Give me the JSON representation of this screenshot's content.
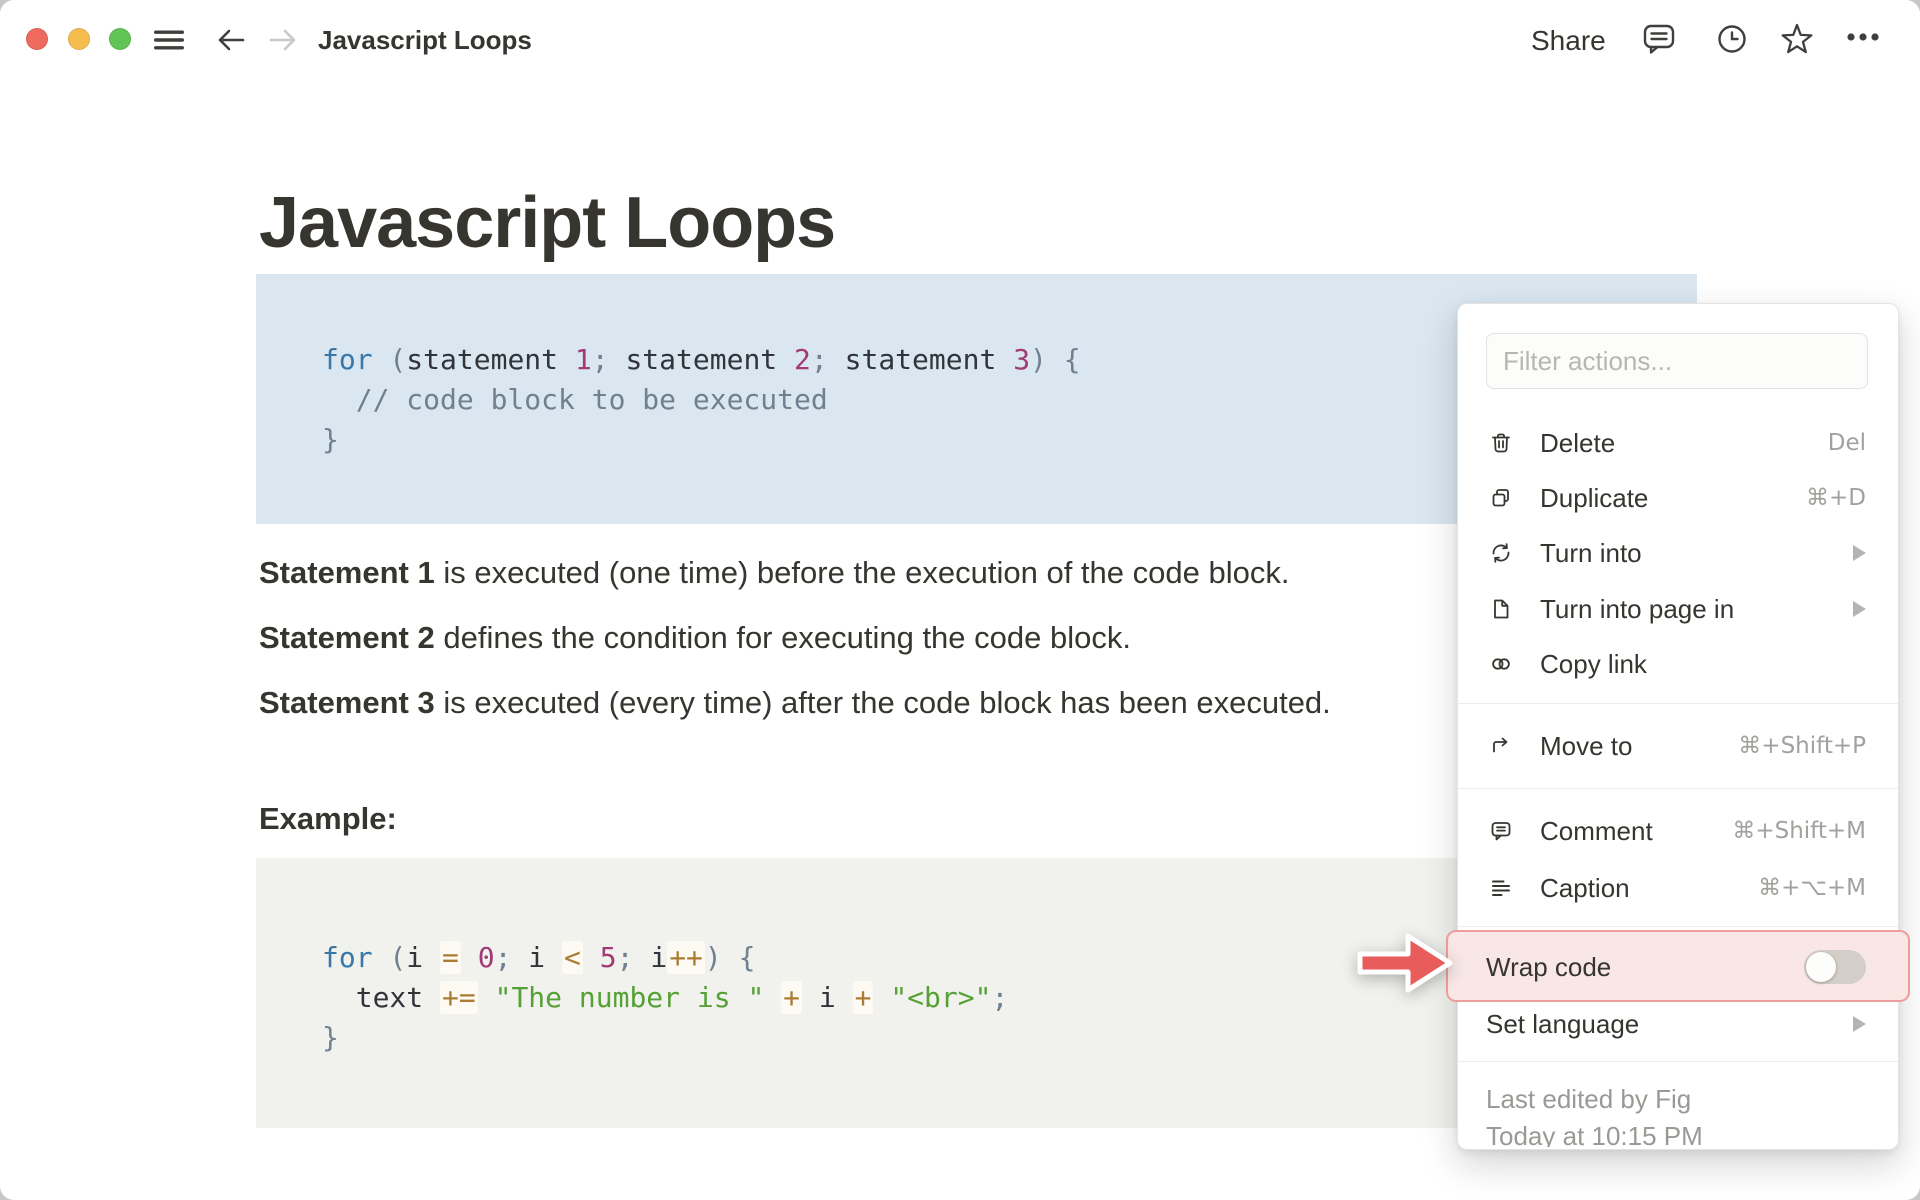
{
  "titlebar": {
    "title": "Javascript Loops",
    "share": "Share",
    "icons": [
      "hamburger-icon",
      "back-icon",
      "forward-icon",
      "comment-bubble-icon",
      "history-clock-icon",
      "star-icon",
      "more-ellipsis-icon"
    ],
    "traffic_lights": [
      "close",
      "minimize",
      "zoom"
    ]
  },
  "doc": {
    "title": "Javascript Loops",
    "paragraphs": [
      {
        "lead": "Statement 1",
        "rest": " is executed (one time) before the execution of the code block."
      },
      {
        "lead": "Statement 2",
        "rest": " defines the condition for executing the code block."
      },
      {
        "lead": "Statement 3",
        "rest": " is executed (every time) after the code block has been executed."
      }
    ],
    "example_label": "Example:",
    "code1": {
      "background": "#dae7f0",
      "lines": [
        [
          [
            "kw",
            "for"
          ],
          [
            "pn",
            " ("
          ],
          [
            "tx",
            "statement "
          ],
          [
            "nm",
            "1"
          ],
          [
            "pn",
            ";"
          ],
          [
            "tx",
            " statement "
          ],
          [
            "nm",
            "2"
          ],
          [
            "pn",
            ";"
          ],
          [
            "tx",
            " statement "
          ],
          [
            "nm",
            "3"
          ],
          [
            "pn",
            ") {"
          ]
        ],
        [
          [
            "cm",
            "  // code block to be executed"
          ]
        ],
        [
          [
            "pn",
            "}"
          ]
        ]
      ]
    },
    "code2": {
      "background": "#f1f1ed",
      "lines": [
        [
          [
            "kw",
            "for"
          ],
          [
            "pn",
            " ("
          ],
          [
            "tx",
            "i "
          ],
          [
            "op",
            "="
          ],
          [
            "tx",
            " "
          ],
          [
            "nm",
            "0"
          ],
          [
            "pn",
            ";"
          ],
          [
            "tx",
            " i "
          ],
          [
            "op",
            "<"
          ],
          [
            "tx",
            " "
          ],
          [
            "nm",
            "5"
          ],
          [
            "pn",
            ";"
          ],
          [
            "tx",
            " i"
          ],
          [
            "op",
            "++"
          ],
          [
            "pn",
            ") {"
          ]
        ],
        [
          [
            "tx",
            "  text "
          ],
          [
            "op",
            "+="
          ],
          [
            "tx",
            " "
          ],
          [
            "st",
            "\"The number is \""
          ],
          [
            "tx",
            " "
          ],
          [
            "op",
            "+"
          ],
          [
            "tx",
            " i "
          ],
          [
            "op",
            "+"
          ],
          [
            "tx",
            " "
          ],
          [
            "st",
            "\"<br>\""
          ],
          [
            "pn",
            ";"
          ]
        ],
        [
          [
            "pn",
            "}"
          ]
        ]
      ]
    }
  },
  "menu": {
    "filter_placeholder": "Filter actions...",
    "items": [
      {
        "icon": "trash-icon",
        "label": "Delete",
        "shortcut": "Del"
      },
      {
        "icon": "duplicate-icon",
        "label": "Duplicate",
        "shortcut": "⌘+D"
      },
      {
        "icon": "turn-into-icon",
        "label": "Turn into",
        "submenu": true
      },
      {
        "icon": "page-icon",
        "label": "Turn into page in",
        "submenu": true
      },
      {
        "icon": "copy-link-icon",
        "label": "Copy link"
      },
      {
        "icon": "move-to-icon",
        "label": "Move to",
        "shortcut": "⌘+Shift+P"
      },
      {
        "icon": "comment-icon",
        "label": "Comment",
        "shortcut": "⌘+Shift+M"
      },
      {
        "icon": "caption-icon",
        "label": "Caption",
        "shortcut": "⌘+⌥+M"
      },
      {
        "label": "Wrap code",
        "toggle": "off",
        "highlighted": true
      },
      {
        "label": "Set language",
        "submenu": true
      }
    ],
    "footer": {
      "by": "Last edited by Fig",
      "at": "Today at 10:15 PM"
    }
  },
  "annotation": {
    "arrow_color": "#e85c5c",
    "highlight_fill": "#f8e7e5",
    "highlight_border": "#ec9e9c"
  }
}
